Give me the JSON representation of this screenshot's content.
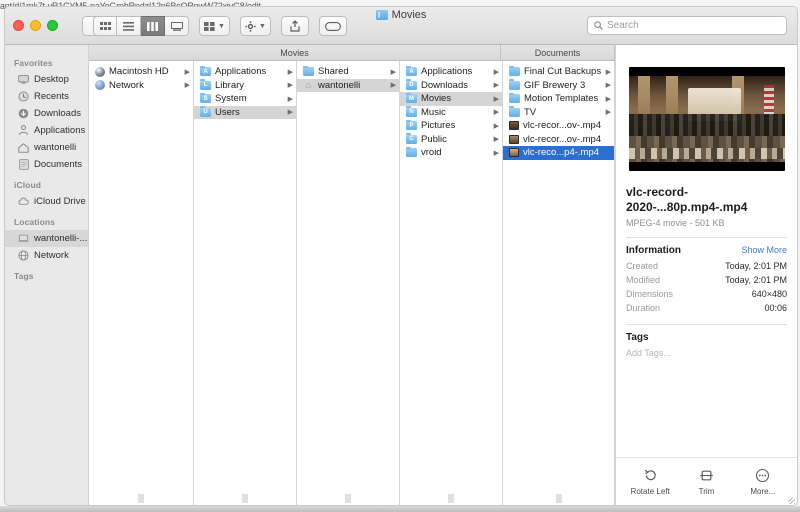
{
  "background": {
    "url_text": "ant/d/1mk7t-vR1CYM5-naYoGrphRndzI12n6BcORnwW72xivG8/edit"
  },
  "window": {
    "title": "Movies",
    "traffic_lights": [
      "close",
      "minimize",
      "zoom"
    ]
  },
  "toolbar": {
    "back_label": "‹",
    "forward_label": "›",
    "view_modes": [
      {
        "name": "icon-view",
        "selected": false
      },
      {
        "name": "list-view",
        "selected": false
      },
      {
        "name": "column-view",
        "selected": true
      },
      {
        "name": "gallery-view",
        "selected": false
      }
    ],
    "group_by_label": "group-by",
    "action_label": "action",
    "share_label": "share",
    "tags_label": "tags"
  },
  "search": {
    "placeholder": "Search",
    "value": ""
  },
  "sidebar": {
    "sections": [
      {
        "title": "Favorites",
        "items": [
          {
            "label": "Desktop",
            "icon": "desktop-icon",
            "selected": false
          },
          {
            "label": "Recents",
            "icon": "clock-icon",
            "selected": false
          },
          {
            "label": "Downloads",
            "icon": "download-icon",
            "selected": false
          },
          {
            "label": "Applications",
            "icon": "applications-icon",
            "selected": false
          },
          {
            "label": "wantonelli",
            "icon": "home-icon",
            "selected": false
          },
          {
            "label": "Documents",
            "icon": "documents-icon",
            "selected": false
          }
        ]
      },
      {
        "title": "iCloud",
        "items": [
          {
            "label": "iCloud Drive",
            "icon": "cloud-icon",
            "selected": false
          }
        ]
      },
      {
        "title": "Locations",
        "items": [
          {
            "label": "wantonelli-...",
            "icon": "laptop-icon",
            "selected": true
          },
          {
            "label": "Network",
            "icon": "globe-icon",
            "selected": false
          }
        ]
      },
      {
        "title": "Tags",
        "items": []
      }
    ]
  },
  "column_headers": [
    {
      "label": "Movies"
    },
    {
      "label": "Documents"
    }
  ],
  "columns": [
    {
      "id": "col-1",
      "rows": [
        {
          "label": "Macintosh HD",
          "icon": "harddisk-icon",
          "arrow": true,
          "state": "none"
        },
        {
          "label": "Network",
          "icon": "network-globe-icon",
          "arrow": true,
          "state": "none"
        }
      ]
    },
    {
      "id": "col-2",
      "rows": [
        {
          "label": "Applications",
          "icon": "folder-icon-a",
          "arrow": true,
          "state": "none"
        },
        {
          "label": "Library",
          "icon": "folder-icon-l",
          "arrow": true,
          "state": "none"
        },
        {
          "label": "System",
          "icon": "folder-icon-s",
          "arrow": true,
          "state": "none"
        },
        {
          "label": "Users",
          "icon": "folder-icon-u",
          "arrow": true,
          "state": "grey"
        }
      ]
    },
    {
      "id": "col-3",
      "rows": [
        {
          "label": "Shared",
          "icon": "folder-icon",
          "arrow": true,
          "state": "none"
        },
        {
          "label": "wantonelli",
          "icon": "home-folder-icon",
          "arrow": true,
          "state": "grey"
        }
      ]
    },
    {
      "id": "col-4",
      "rows": [
        {
          "label": "Applications",
          "icon": "folder-icon-a",
          "arrow": true,
          "state": "none"
        },
        {
          "label": "Downloads",
          "icon": "folder-icon-d",
          "arrow": true,
          "state": "none"
        },
        {
          "label": "Movies",
          "icon": "folder-icon-m",
          "arrow": true,
          "state": "grey"
        },
        {
          "label": "Music",
          "icon": "folder-icon-n",
          "arrow": true,
          "state": "none"
        },
        {
          "label": "Pictures",
          "icon": "folder-icon-p",
          "arrow": true,
          "state": "none"
        },
        {
          "label": "Public",
          "icon": "folder-icon-c",
          "arrow": true,
          "state": "none"
        },
        {
          "label": "vroid",
          "icon": "folder-icon",
          "arrow": true,
          "state": "none"
        }
      ]
    },
    {
      "id": "col-5",
      "rows": [
        {
          "label": "Final Cut Backups",
          "icon": "folder-icon",
          "arrow": true,
          "state": "none"
        },
        {
          "label": "GIF Brewery 3",
          "icon": "folder-icon",
          "arrow": true,
          "state": "none"
        },
        {
          "label": "Motion Templates",
          "icon": "folder-icon",
          "arrow": true,
          "state": "none"
        },
        {
          "label": "TV",
          "icon": "folder-icon",
          "arrow": true,
          "state": "none"
        },
        {
          "label": "vlc-recor...ov-.mp4",
          "icon": "movie-thumb-icon",
          "arrow": false,
          "state": "none"
        },
        {
          "label": "vlc-recor...ov-.mp4",
          "icon": "movie-thumb-icon",
          "arrow": false,
          "state": "none"
        },
        {
          "label": "vlc-reco...p4-.mp4",
          "icon": "movie-thumb-icon",
          "arrow": false,
          "state": "blue"
        }
      ]
    }
  ],
  "preview": {
    "thumbnail_name": "video-thumbnail",
    "file_name": "vlc-record-2020-...80p.mp4-.mp4",
    "file_meta": "MPEG-4 movie - 501 KB",
    "information": {
      "heading": "Information",
      "show_more": "Show More",
      "rows": [
        {
          "key": "Created",
          "value": "Today, 2:01 PM"
        },
        {
          "key": "Modified",
          "value": "Today, 2:01 PM"
        },
        {
          "key": "Dimensions",
          "value": "640×480"
        },
        {
          "key": "Duration",
          "value": "00:06"
        }
      ]
    },
    "tags": {
      "heading": "Tags",
      "placeholder": "Add Tags..."
    },
    "actions": [
      {
        "label": "Rotate Left",
        "icon": "rotate-left-icon"
      },
      {
        "label": "Trim",
        "icon": "trim-icon"
      },
      {
        "label": "More...",
        "icon": "more-icon"
      }
    ]
  },
  "colors": {
    "selection_blue": "#2b6fd4",
    "selection_grey": "#d5d5d5",
    "link_blue": "#3b7ddd",
    "sidebar_bg": "#e9e9ea"
  }
}
